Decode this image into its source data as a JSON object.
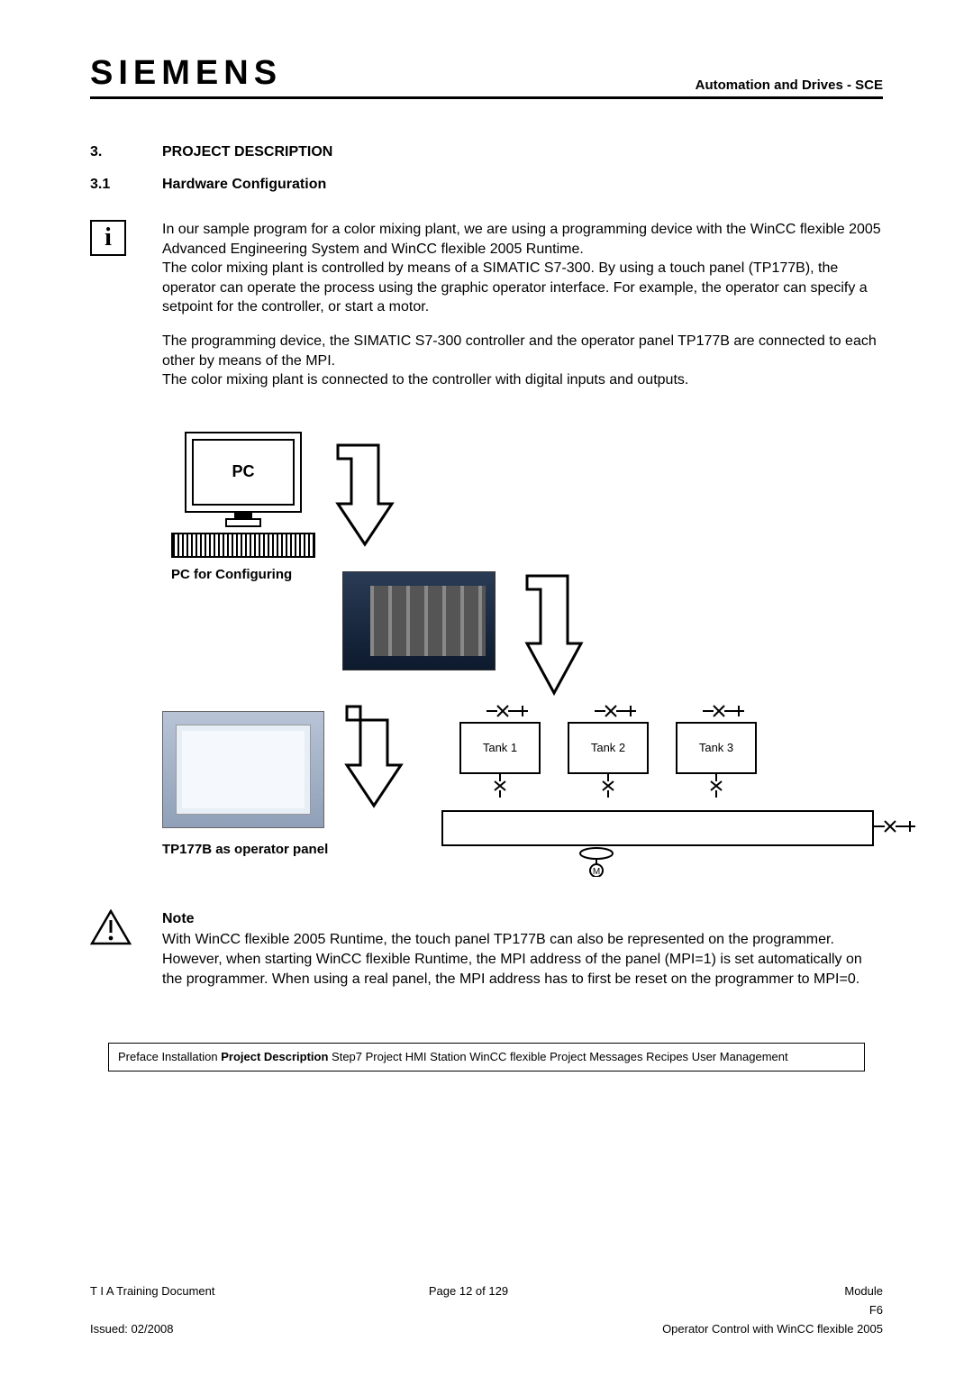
{
  "header": {
    "logo": "SIEMENS",
    "right": "Automation and Drives - SCE"
  },
  "section": {
    "num1": "3.",
    "title1": "PROJECT DESCRIPTION",
    "num2": "3.1",
    "title2": "Hardware Configuration"
  },
  "intro": {
    "p1": "In our sample program for a color mixing plant, we are using a programming device with the WinCC flexible 2005 Advanced Engineering System and WinCC flexible 2005 Runtime.",
    "p2": "The color mixing plant is controlled by means of a SIMATIC S7-300. By using a touch panel (TP177B), the operator can operate the process using the graphic operator interface. For example, the operator can specify a setpoint for the controller, or start a motor.",
    "p3": "The programming device, the SIMATIC S7-300 controller and the operator panel TP177B are connected to each other by means of the MPI.",
    "p4": "The color mixing plant is connected to the controller with digital inputs and outputs."
  },
  "figure": {
    "pc_screen": "PC",
    "pc_label": "PC for Configuring",
    "tp_label": "TP177B as operator panel",
    "tank1": "Tank 1",
    "tank2": "Tank 2",
    "tank3": "Tank 3",
    "motor": "M"
  },
  "note": {
    "h": "Note",
    "body": "With WinCC flexible 2005 Runtime, the touch panel TP177B can also be represented on the programmer.  However, when starting WinCC flexible Runtime, the MPI address of the panel (MPI=1) is set automatically on the programmer. When using a real panel, the MPI address has to first be reset on the programmer to MPI=0."
  },
  "breadcrumb": {
    "items": [
      {
        "t": "Preface",
        "a": false
      },
      {
        "t": "Installation",
        "a": false
      },
      {
        "t": "Project Description",
        "a": true
      },
      {
        "t": "Step7 Project",
        "a": false
      },
      {
        "t": "HMI Station",
        "a": false
      },
      {
        "t": "WinCC flexible Project",
        "a": false
      },
      {
        "t": "Messages",
        "a": false
      },
      {
        "t": "Recipes",
        "a": false
      },
      {
        "t": "User Management",
        "a": false
      }
    ]
  },
  "footer": {
    "l1_left": "T I A  Training Document",
    "l1_mid": "Page 12 of 129",
    "l1_right": "Module",
    "l2_right1": "F6",
    "l2_left": "Issued: 02/2008",
    "l2_right": "Operator Control with WinCC flexible 2005"
  }
}
